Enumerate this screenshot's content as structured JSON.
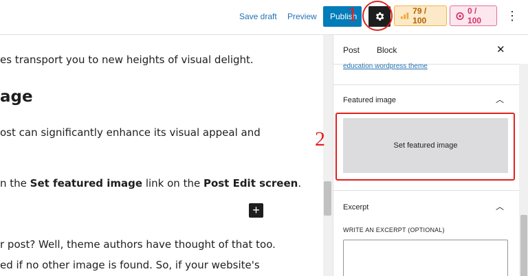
{
  "toolbar": {
    "save_draft": "Save draft",
    "preview": "Preview",
    "publish": "Publish",
    "score_a": "79 / 100",
    "score_b": "0 / 100",
    "accent": "#007cba"
  },
  "annotations": {
    "one": "1",
    "two": "2",
    "color": "#e0201c"
  },
  "editor": {
    "line1": "es transport you to new heights of visual delight.",
    "heading": "age",
    "line2": "ost can significantly enhance its visual appeal and",
    "line3_a": "n the ",
    "line3_b": "Set featured image",
    "line3_c": " link on the ",
    "line3_d": "Post Edit screen",
    "line3_e": ".",
    "line4": "r post? Well, theme authors have thought of that too.",
    "line5": "ed if no other image is found. So, if your website's",
    "plus": "+"
  },
  "sidebar": {
    "tab_post": "Post",
    "tab_block": "Block",
    "close": "✕",
    "cut_link": "education wordpress theme",
    "featured_title": "Featured image",
    "featured_button": "Set featured image",
    "excerpt_title": "Excerpt",
    "excerpt_label": "WRITE AN EXCERPT (OPTIONAL)"
  },
  "icons": [
    "gear-icon",
    "seo-score-icon",
    "readability-score-icon",
    "more-options-icon",
    "close-icon",
    "chevron-up-icon",
    "plus-icon"
  ]
}
